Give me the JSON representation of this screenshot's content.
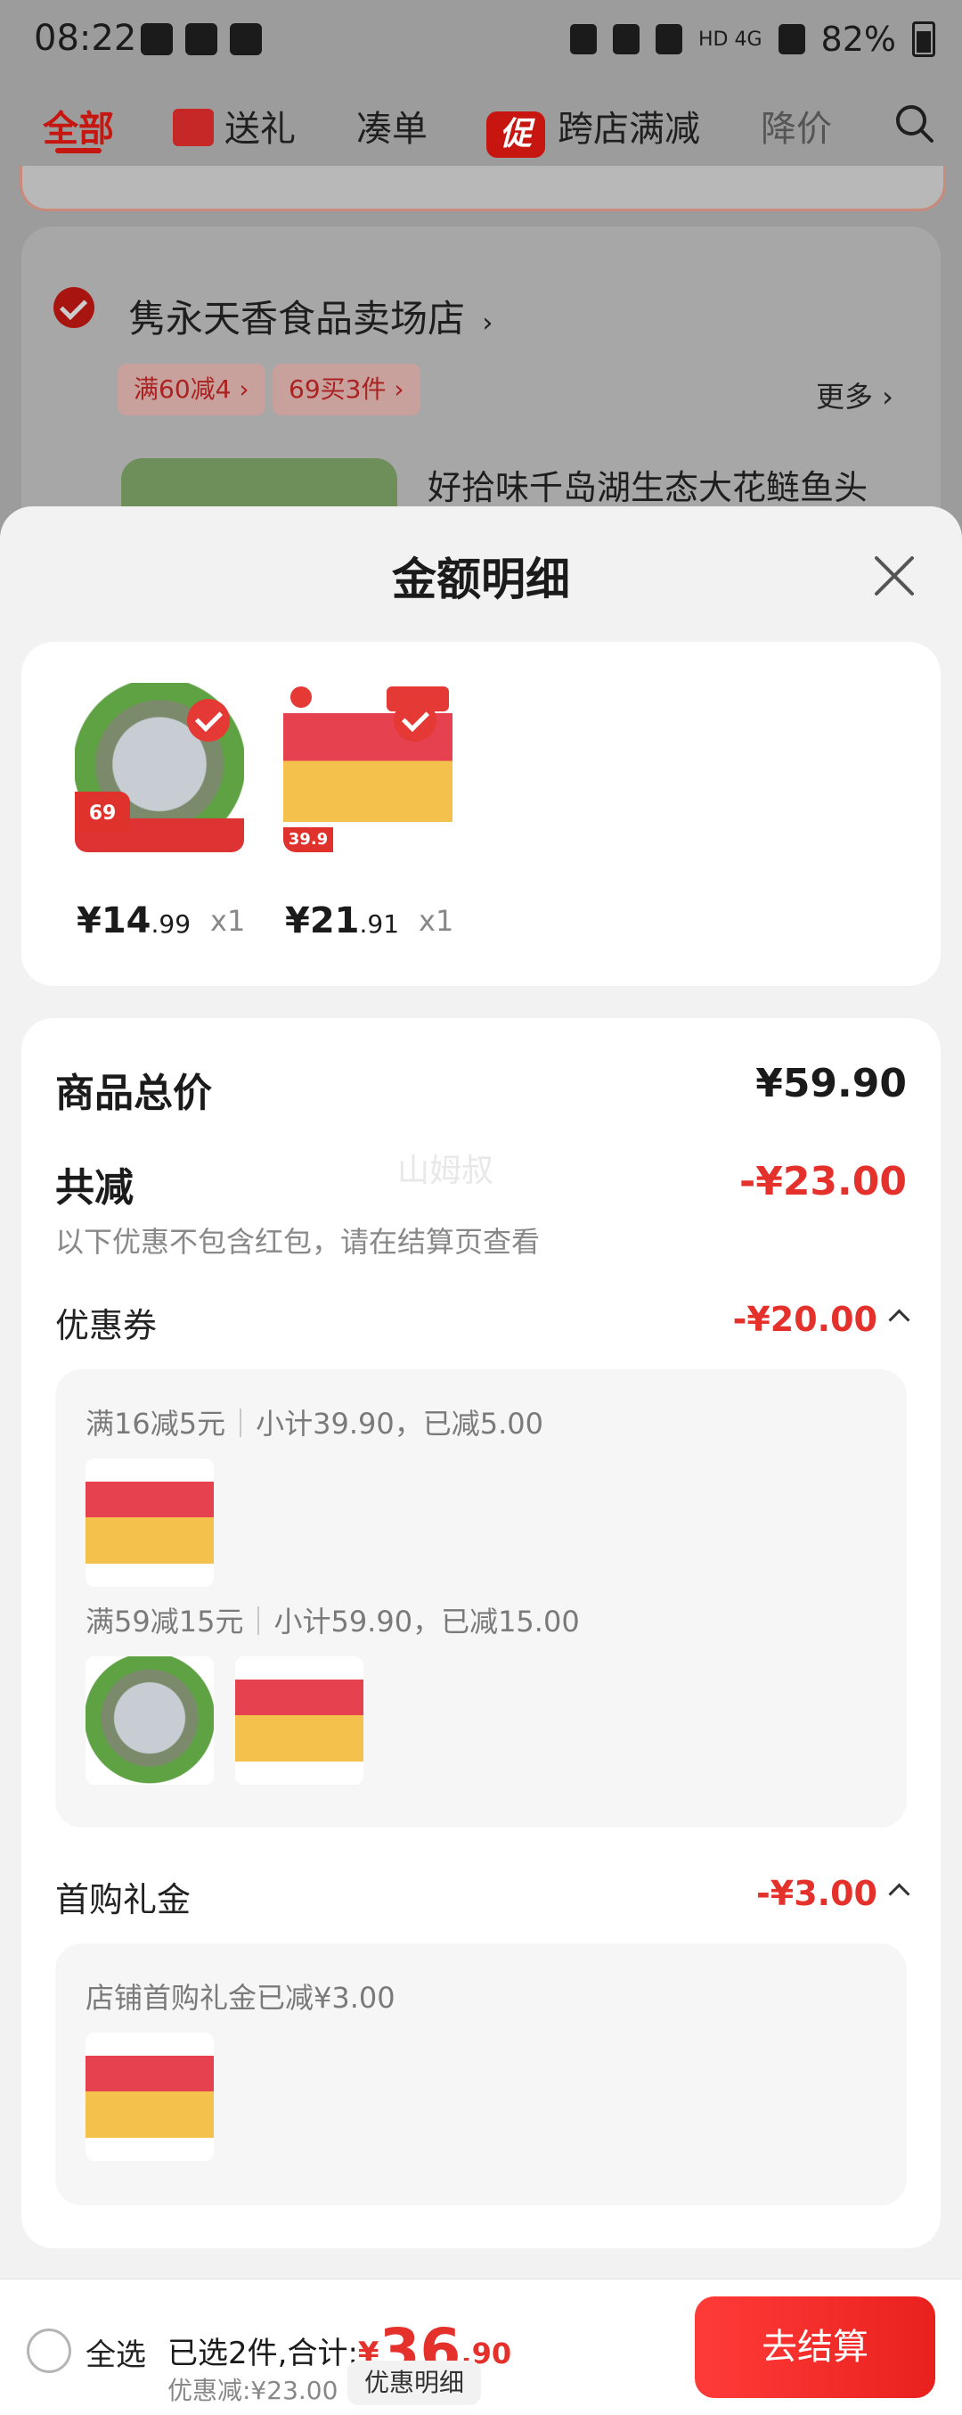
{
  "status_bar": {
    "time": "08:22",
    "network": "HD 4G",
    "battery": "82%"
  },
  "tabs": [
    {
      "label": "全部"
    },
    {
      "label": "送礼"
    },
    {
      "label": "凑单"
    },
    {
      "label": "跨店满减",
      "badge": "促"
    },
    {
      "label": "降价"
    }
  ],
  "background": {
    "store_name": "隽永天香食品卖场店",
    "store_arrow": "›",
    "promo_tags": [
      "满60减4 ›",
      "69买3件 ›"
    ],
    "more": "更多 ›",
    "product_title": "好拾味千岛湖生态大花鲢鱼头"
  },
  "sheet": {
    "title": "金额明细",
    "items": [
      {
        "price_int": "¥14",
        "price_dec": ".99",
        "qty": "x1",
        "thumb_price": "69"
      },
      {
        "price_int": "¥21",
        "price_dec": ".91",
        "qty": "x1",
        "thumb_price": "39.9"
      }
    ],
    "total_label": "商品总价",
    "total_value": "¥59.90",
    "reduce_label": "共减",
    "reduce_value": "-¥23.00",
    "note": "以下优惠不包含红包，请在结算页查看",
    "watermark": "山姆叔",
    "coupon": {
      "label": "优惠券",
      "value": "-¥20.00",
      "rule1": "满16减5元",
      "detail1": "小计39.90，已减5.00",
      "rule2": "满59减15元",
      "detail2": "小计59.90，已减15.00"
    },
    "first_buy": {
      "label": "首购礼金",
      "value": "-¥3.00",
      "text": "店铺首购礼金已减¥3.00"
    }
  },
  "bottom_bar": {
    "select_all": "全选",
    "selected_text": "已选2件,合计:",
    "total_symbol": "¥",
    "total_int": "36",
    "total_dec": ".90",
    "discount": "优惠减:¥23.00",
    "detail_button": "优惠明细",
    "checkout": "去结算"
  },
  "colors": {
    "accent": "#e4312b",
    "checkout": "#f0302c"
  }
}
